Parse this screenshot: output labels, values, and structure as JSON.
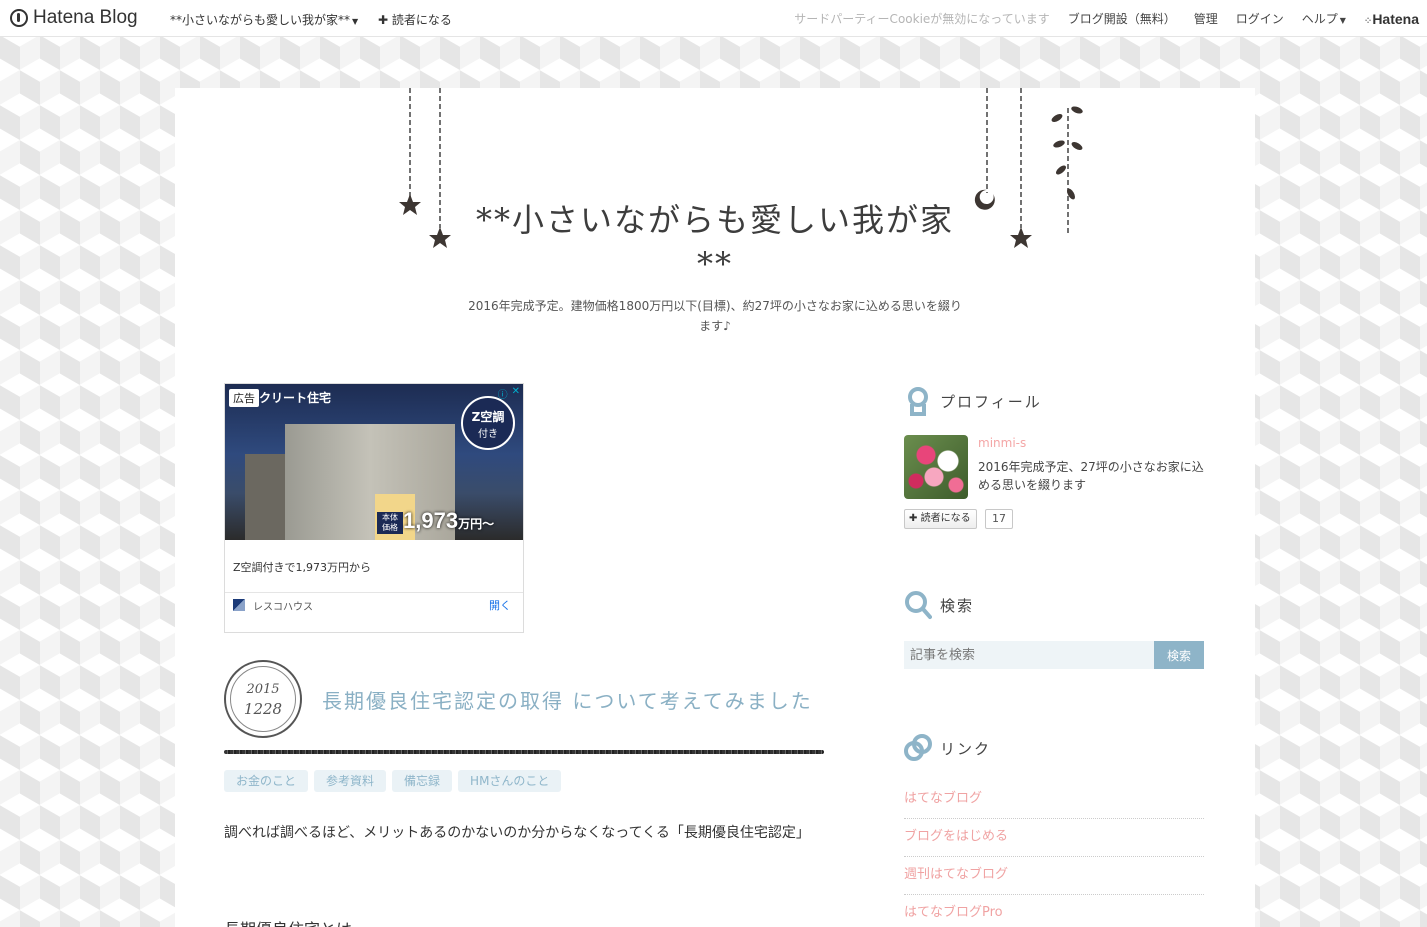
{
  "topbar": {
    "logo_text": "Hatena Blog",
    "blog_name": "**小さいながらも愛しい我が家**",
    "subscribe": "読者になる",
    "cookie_notice": "サードパーティーCookieが無効になっています",
    "open_blog": "ブログ開設（無料）",
    "admin": "管理",
    "login": "ログイン",
    "help": "ヘルプ",
    "hatena": "Hatena"
  },
  "header": {
    "title": "**小さいながらも愛しい我が家**",
    "description": "2016年完成予定。建物価格1800万円以下(目標)、約27坪の小さなお家に込める思いを綴ります♪"
  },
  "ad": {
    "label": "広告",
    "headline": "クリート住宅",
    "badge_line1": "Z空調",
    "badge_line2": "付き",
    "price_tag": "本体価格",
    "price": "1,973",
    "price_unit": "万円～",
    "text": "Z空調付きで1,973万円から",
    "advertiser": "レスコハウス",
    "open": "開く"
  },
  "entry": {
    "year": "2015",
    "month_day": "1228",
    "title": "長期優良住宅認定の取得 について考えてみました",
    "categories": [
      "お金のこと",
      "参考資料",
      "備忘録",
      "HMさんのこと"
    ],
    "body": "調べれば調べるほど、メリットあるのかないのか分からなくなってくる「長期優良住宅認定」",
    "next_heading": "長期優良住宅とは"
  },
  "sidebar": {
    "profile": {
      "heading": "プロフィール",
      "name": "minmi-s",
      "description": "2016年完成予定、27坪の小さなお家に込める思いを綴ります",
      "reader_button": "読者になる",
      "reader_count": "17"
    },
    "search": {
      "heading": "検索",
      "placeholder": "記事を検索",
      "button": "検索"
    },
    "links": {
      "heading": "リンク",
      "items": [
        "はてなブログ",
        "ブログをはじめる",
        "週刊はてなブログ",
        "はてなブログPro"
      ]
    }
  },
  "colors": {
    "accent_blue": "#8eb4c8",
    "link_pink": "#f0a3a3",
    "category_bg": "#eaf2f6"
  }
}
